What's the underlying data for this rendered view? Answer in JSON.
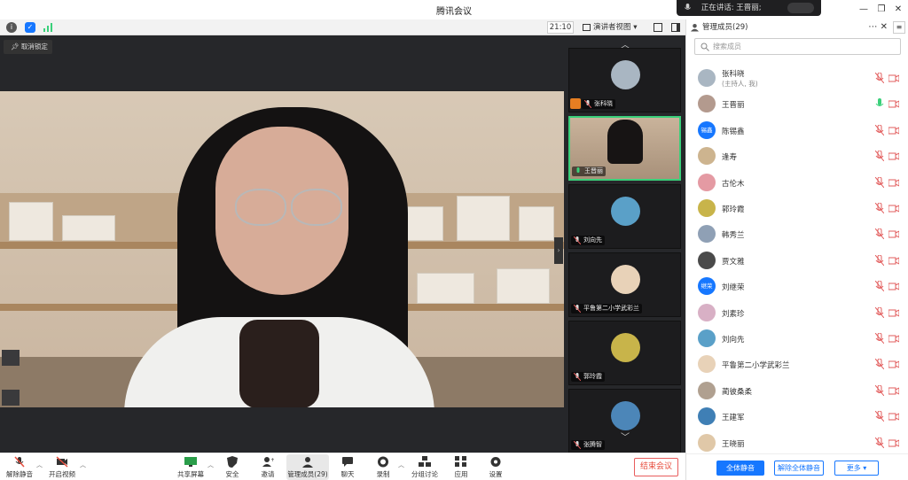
{
  "window": {
    "title": "腾讯会议",
    "speaking_text": "正在讲话: 王晋丽;"
  },
  "subbar": {
    "time": "21:10",
    "view_label": "演讲者视图"
  },
  "stage": {
    "unpin_label": "取消锁定",
    "tiles": [
      {
        "name": "张科晓",
        "host": true,
        "active": false,
        "avatar_color": "#a9b6c2"
      },
      {
        "name": "王晋丽",
        "host": false,
        "active": true,
        "avatar_color": "#d6a68f"
      },
      {
        "name": "刘向先",
        "host": false,
        "active": false,
        "avatar_color": "#5aa0c8"
      },
      {
        "name": "平鲁第二小学武彩兰",
        "host": false,
        "active": false,
        "avatar_color": "#e8d2b8"
      },
      {
        "name": "郭玲霞",
        "host": false,
        "active": false,
        "avatar_color": "#c8b44a"
      },
      {
        "name": "张腾智",
        "host": false,
        "active": false,
        "avatar_color": "#4c86b8"
      }
    ]
  },
  "toolbar": {
    "unmute": "解除静音",
    "start_video": "开启视频",
    "share_screen": "共享屏幕",
    "security": "安全",
    "invite": "邀请",
    "manage_members": "管理成员(29)",
    "chat": "聊天",
    "record": "录制",
    "breakout": "分组讨论",
    "apps": "应用",
    "settings": "设置",
    "end_meeting": "结束会议"
  },
  "panel": {
    "title": "管理成员(29)",
    "search_placeholder": "搜索成员",
    "members": [
      {
        "name": "张科晓",
        "sub": "(主持人, 我)",
        "avatar_color": "#a9b6c2",
        "avatar_text": "",
        "mic": "muted"
      },
      {
        "name": "王晋丽",
        "sub": "",
        "avatar_color": "#b39a8e",
        "avatar_text": "",
        "mic": "active"
      },
      {
        "name": "陈锡鑫",
        "sub": "",
        "avatar_color": "#1677ff",
        "avatar_text": "锡鑫",
        "mic": "muted"
      },
      {
        "name": "逢寿",
        "sub": "",
        "avatar_color": "#cdb48f",
        "avatar_text": "",
        "mic": "muted"
      },
      {
        "name": "古伦木",
        "sub": "",
        "avatar_color": "#e49aa3",
        "avatar_text": "",
        "mic": "muted"
      },
      {
        "name": "郭玲霞",
        "sub": "",
        "avatar_color": "#c8b44a",
        "avatar_text": "",
        "mic": "muted"
      },
      {
        "name": "韩秀兰",
        "sub": "",
        "avatar_color": "#8fa0b5",
        "avatar_text": "",
        "mic": "muted"
      },
      {
        "name": "贾文雅",
        "sub": "",
        "avatar_color": "#4a4a4a",
        "avatar_text": "",
        "mic": "muted"
      },
      {
        "name": "刘继荣",
        "sub": "",
        "avatar_color": "#1677ff",
        "avatar_text": "继荣",
        "mic": "muted"
      },
      {
        "name": "刘素珍",
        "sub": "",
        "avatar_color": "#d8b0c5",
        "avatar_text": "",
        "mic": "muted"
      },
      {
        "name": "刘向先",
        "sub": "",
        "avatar_color": "#5aa0c8",
        "avatar_text": "",
        "mic": "muted"
      },
      {
        "name": "平鲁第二小学武彩兰",
        "sub": "",
        "avatar_color": "#e8d2b8",
        "avatar_text": "",
        "mic": "muted"
      },
      {
        "name": "蔺彼桑柔",
        "sub": "",
        "avatar_color": "#b0a090",
        "avatar_text": "",
        "mic": "muted"
      },
      {
        "name": "王建军",
        "sub": "",
        "avatar_color": "#3f7fb5",
        "avatar_text": "",
        "mic": "muted"
      },
      {
        "name": "王晓丽",
        "sub": "",
        "avatar_color": "#e0c8a8",
        "avatar_text": "",
        "mic": "muted"
      }
    ],
    "mute_all": "全体静音",
    "unmute_all": "解除全体静音",
    "more": "更多 ▾"
  },
  "colors": {
    "accent": "#1677ff",
    "danger": "#e74c3c",
    "muted_icon": "#e25c5c",
    "active_mic": "#3ad07a",
    "stage_bg": "#26272a"
  }
}
